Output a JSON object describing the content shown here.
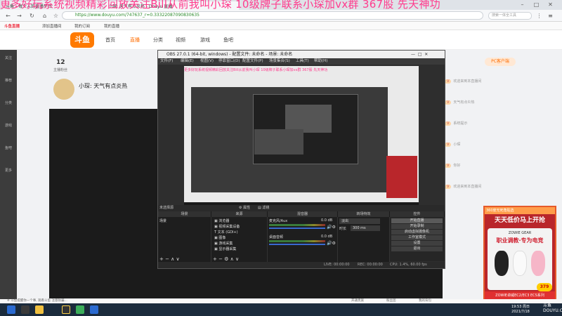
{
  "overlay_text": "更多好玩系统视频精彩回放关注Bill从前我叫小琛 10级牌子联系小琛加vx群  367股 先天神功",
  "overlay_text_small": "更多好玩系统视频精彩回放关注Bill从前我叫小琛 10级牌子联系小琛加vx群  367股 先天神功",
  "browser": {
    "tabs": [
      "斗鱼 - 每个人的直播平台",
      "小琛: 天气有点炎热 - Douyu 直播"
    ],
    "url": "https://www.douyu.com/747637_r=0.33322087090830635",
    "search_placeholder": "搜索一体全工具",
    "bookmarks": [
      "斗鱼直播",
      "添加直播间",
      "我的订阅",
      "我的直播"
    ]
  },
  "site": {
    "logo": "斗鱼",
    "nav": [
      "首页",
      "直播",
      "分类",
      "视频",
      "游戏",
      "鱼吧"
    ],
    "pc_client": "PC客户端"
  },
  "room": {
    "anchor_name": "小琛: 天气有点炎热",
    "fans_count": "12",
    "fans_label": "主播粉丝"
  },
  "rail": [
    "关注",
    "推荐",
    "分类",
    "游戏",
    "鱼吧",
    "更多"
  ],
  "chat": {
    "lines": [
      "欢迎来到本直播间",
      "天气有点炎热",
      "系统提示",
      "小琛",
      "你好",
      "欢迎来到本直播间"
    ]
  },
  "obs": {
    "title": "OBS 27.0.1 (64-bit, windows) - 配置文件: 未命名 - 场景: 未命名",
    "menu": [
      "文件(F)",
      "编辑(E)",
      "视图(V)",
      "停靠窗口(D)",
      "配置文件(P)",
      "场景集合(S)",
      "工具(T)",
      "帮助(H)"
    ],
    "no_source": "未选择源",
    "properties": "属性",
    "filters": "滤镜",
    "docks": [
      "场景",
      "来源",
      "混音器",
      "转场特效",
      "控件"
    ],
    "scene_item": "场景",
    "sources": [
      "浏览器",
      "视频采集设备",
      "文本 (GDI+)",
      "图像",
      "游戏采集",
      "显示器采集"
    ],
    "mixer": [
      {
        "name": "麦克风/Aux",
        "db": "0.0 dB"
      },
      {
        "name": "桌面音频",
        "db": "0.0 dB"
      }
    ],
    "transition": "淡出",
    "duration_label": "时长",
    "duration_value": "300 ms",
    "controls": [
      "开始直播",
      "开始录制",
      "启动虚拟摄像机",
      "工作室模式",
      "设置",
      "退出"
    ],
    "status": {
      "live": "LIVE: 00:00:00",
      "rec": "REC: 00:00:00",
      "cpu": "CPU: 1.4%, 60.00 fps"
    }
  },
  "ad": {
    "top": "360度无死角贴选",
    "headline": "天天低价马上开抢",
    "brand": "ZOWIE GEAR",
    "slogan": "职业调教·专为电竞",
    "price": "379",
    "footer": "ZOWIE卓威EC2/EC3 ECS系列"
  },
  "watermark": "斗鱼 DOUYU.COM",
  "notice": "※ 斗鱼提醒你一个事, 观看斗鱼 注意防骗...",
  "gift_items": [
    "开通贵族",
    "粉丝团",
    "我的背包"
  ],
  "taskbar": {
    "time": "19:53 周日",
    "date": "2021/7/18"
  },
  "colors": {
    "overlay": "#ff3b8d",
    "brand": "#ff7a00",
    "ad": "#b9262b"
  }
}
